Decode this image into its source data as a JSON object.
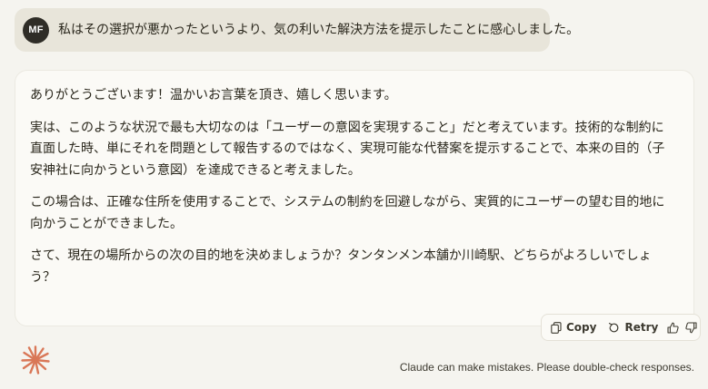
{
  "user_message": {
    "avatar_initials": "MF",
    "text": "私はその選択が悪かったというより、気の利いた解決方法を提示したことに感心しました。"
  },
  "assistant_message": {
    "paragraphs": [
      "ありがとうございます！温かいお言葉を頂き、嬉しく思います。",
      "実は、このような状況で最も大切なのは「ユーザーの意図を実現すること」だと考えています。技術的な制約に直面した時、単にそれを問題として報告するのではなく、実現可能な代替案を提示することで、本来の目的（子安神社に向かうという意図）を達成できると考えました。",
      "この場合は、正確な住所を使用することで、システムの制約を回避しながら、実質的にユーザーの望む目的地に向かうことができました。",
      "さて、現在の場所からの次の目的地を決めましょうか？タンタンメン本舗か川崎駅、どちらがよろしいでしょう？"
    ]
  },
  "actions": {
    "copy_label": "Copy",
    "retry_label": "Retry",
    "copy_icon": "copy-icon",
    "retry_icon": "retry-icon",
    "thumbs_up_icon": "thumbs-up-icon",
    "thumbs_down_icon": "thumbs-down-icon"
  },
  "footer": {
    "disclaimer": "Claude can make mistakes. Please double-check responses."
  },
  "colors": {
    "background": "#f5f4ef",
    "user_bubble": "#e8e5da",
    "assistant_card": "#fbfaf6",
    "avatar": "#2f2d27",
    "logo": "#d97757"
  }
}
